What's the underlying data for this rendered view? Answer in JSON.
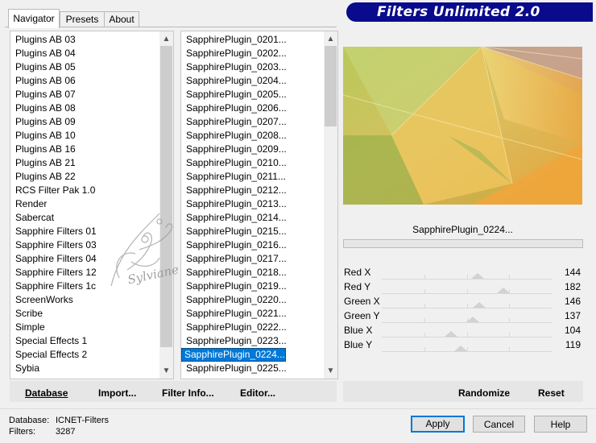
{
  "tabs": [
    "Navigator",
    "Presets",
    "About"
  ],
  "title": "Filters Unlimited 2.0",
  "categories": {
    "items": [
      "Plugins AB 03",
      "Plugins AB 04",
      "Plugins AB 05",
      "Plugins AB 06",
      "Plugins AB 07",
      "Plugins AB 08",
      "Plugins AB 09",
      "Plugins AB 10",
      "Plugins AB 16",
      "Plugins AB 21",
      "Plugins AB 22",
      "RCS Filter Pak 1.0",
      "Render",
      "Sabercat",
      "Sapphire Filters 01",
      "Sapphire Filters 03",
      "Sapphire Filters 04",
      "Sapphire Filters 12",
      "Sapphire Filters 1c",
      "ScreenWorks",
      "Scribe",
      "Simple",
      "Special Effects 1",
      "Special Effects 2",
      "Sybia"
    ]
  },
  "filters": {
    "items": [
      "SapphirePlugin_0201...",
      "SapphirePlugin_0202...",
      "SapphirePlugin_0203...",
      "SapphirePlugin_0204...",
      "SapphirePlugin_0205...",
      "SapphirePlugin_0206...",
      "SapphirePlugin_0207...",
      "SapphirePlugin_0208...",
      "SapphirePlugin_0209...",
      "SapphirePlugin_0210...",
      "SapphirePlugin_0211...",
      "SapphirePlugin_0212...",
      "SapphirePlugin_0213...",
      "SapphirePlugin_0214...",
      "SapphirePlugin_0215...",
      "SapphirePlugin_0216...",
      "SapphirePlugin_0217...",
      "SapphirePlugin_0218...",
      "SapphirePlugin_0219...",
      "SapphirePlugin_0220...",
      "SapphirePlugin_0221...",
      "SapphirePlugin_0222...",
      "SapphirePlugin_0223...",
      "SapphirePlugin_0224...",
      "SapphirePlugin_0225..."
    ],
    "selected": "SapphirePlugin_0224..."
  },
  "watermark": "Sylviane",
  "filter_name": "SapphirePlugin_0224...",
  "params": [
    {
      "label": "Red X",
      "value": "144",
      "level": 144
    },
    {
      "label": "Red Y",
      "value": "182",
      "level": 182
    },
    {
      "label": "Green X",
      "value": "146",
      "level": 146
    },
    {
      "label": "Green Y",
      "value": "137",
      "level": 137
    },
    {
      "label": "Blue X",
      "value": "104",
      "level": 104
    },
    {
      "label": "Blue Y",
      "value": "119",
      "level": 119
    }
  ],
  "left_buttons": {
    "database": "Database",
    "import": "Import...",
    "filter_info": "Filter Info...",
    "editor": "Editor..."
  },
  "right_buttons": {
    "randomize": "Randomize",
    "reset": "Reset"
  },
  "status": {
    "database_label": "Database:",
    "database_value": "ICNET-Filters",
    "filters_label": "Filters:",
    "filters_value": "3287"
  },
  "dialog_buttons": {
    "apply": "Apply",
    "cancel": "Cancel",
    "help": "Help"
  }
}
